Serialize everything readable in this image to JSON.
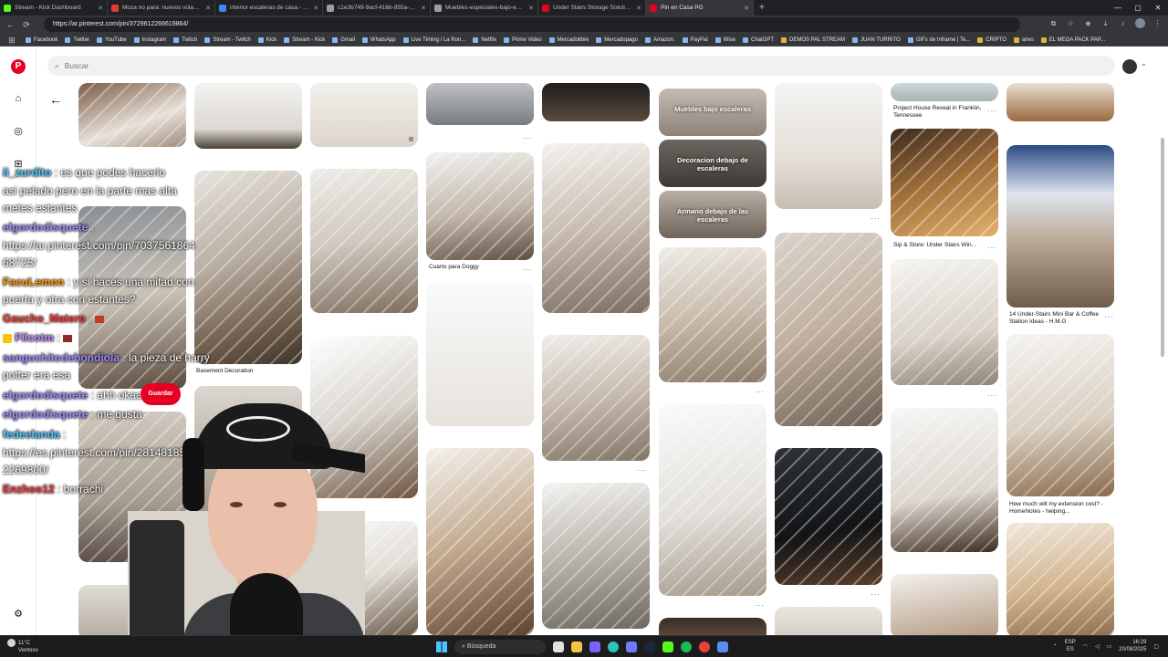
{
  "browser": {
    "tabs": [
      {
        "title": "Stream - Kick Dashboard",
        "color": "#53fc18",
        "active": false
      },
      {
        "title": "Moza no para: nuevos volantes, l...",
        "color": "#e53935",
        "active": false
      },
      {
        "title": "interior escaleras de casa - Buscar",
        "color": "#4285f4",
        "active": false
      },
      {
        "title": "c1e3b749-9acf-416b-955a-3fb47...",
        "color": "#9e9e9e",
        "active": false
      },
      {
        "title": "Muebles-especiales-bajo-escalera...",
        "color": "#9e9e9e",
        "active": false
      },
      {
        "title": "Under Stairs Storage Solutions, B...",
        "color": "#e60023",
        "active": false
      },
      {
        "title": "Pin en Casa PG",
        "color": "#e60023",
        "active": true
      }
    ],
    "new_tab": "+",
    "url": "https://ar.pinterest.com/pin/3729612266619864/",
    "bookmarks": [
      {
        "label": "Facebook",
        "folder": false
      },
      {
        "label": "Twitter",
        "folder": false
      },
      {
        "label": "YouTube",
        "folder": false
      },
      {
        "label": "Instagram",
        "folder": false
      },
      {
        "label": "Twitch",
        "folder": false
      },
      {
        "label": "Stream - Twitch",
        "folder": false
      },
      {
        "label": "Kick",
        "folder": false
      },
      {
        "label": "Stream - Kick",
        "folder": false
      },
      {
        "label": "Gmail",
        "folder": false
      },
      {
        "label": "WhatsApp",
        "folder": false
      },
      {
        "label": "Live Timing / La Ron...",
        "folder": false
      },
      {
        "label": "Netflix",
        "folder": false
      },
      {
        "label": "Prime Video",
        "folder": false
      },
      {
        "label": "Mercadolibre",
        "folder": false
      },
      {
        "label": "Mercadopago",
        "folder": false
      },
      {
        "label": "Amazon.",
        "folder": false
      },
      {
        "label": "PayPal",
        "folder": false
      },
      {
        "label": "Wise",
        "folder": false
      },
      {
        "label": "ChatGPT",
        "folder": false
      },
      {
        "label": "DEMOS PAL STREAM",
        "folder": true
      },
      {
        "label": "JUAN TURRITO",
        "folder": false
      },
      {
        "label": "GIFs de Inframe | Te...",
        "folder": false
      },
      {
        "label": "CRIPTO",
        "folder": true
      },
      {
        "label": "aires",
        "folder": true
      },
      {
        "label": "EL MEGA PACK PAP...",
        "folder": true
      }
    ]
  },
  "pinterest": {
    "search_placeholder": "Buscar",
    "pins": [
      {
        "label": "Muebles bajo escaleras"
      },
      {
        "label": "Decoracion debajo de escaleras"
      },
      {
        "label": "Armario debajo de las escaleras"
      }
    ],
    "captions": {
      "basement": "Basement Decoration",
      "doggy": "Cuarto para Doggy",
      "project_house": "Project House Reveal in Franklin, Tennessee",
      "sip_store": "Sip & Store: Under Stairs Win...",
      "minibar": "14 Under-Stairs Mini Bar & Coffee Station Ideas - H.M.G",
      "extension": "How much will my extension cost? - HomeNotes - helping..."
    },
    "save_button": "Guardar",
    "more": "···"
  },
  "chat": [
    {
      "user": "ii_zurdito",
      "user_color": "#4fc3f7",
      "text": ": es que podes hacerlo"
    },
    {
      "user": "",
      "user_color": "#ffffff",
      "text": "asi pelado pero en la parte mas alta"
    },
    {
      "user": "",
      "user_color": "#ffffff",
      "text": "metes estantes"
    },
    {
      "user": "elgordodisquete",
      "user_color": "#9c8cff",
      "text": ":"
    },
    {
      "user": "",
      "user_color": "#ffffff",
      "text": "https://ar.pinterest.com/pin/7037561864"
    },
    {
      "user": "",
      "user_color": "#ffffff",
      "text": "68725/"
    },
    {
      "user": "FacuLemon",
      "user_color": "#ff9800",
      "text": ": y si hacés una mitad con"
    },
    {
      "user": "",
      "user_color": "#ffffff",
      "text": "puerta y otra con estantes?"
    },
    {
      "user": "Gaucho_Matero",
      "user_color": "#ff3b3b",
      "text": ":"
    },
    {
      "user": "Filcotm",
      "user_color": "#b388ff",
      "text": ":"
    },
    {
      "user": "sanguchitodebondiola",
      "user_color": "#9c8cff",
      "text": ": la pieza de harry"
    },
    {
      "user": "",
      "user_color": "#ffffff",
      "text": "potter era esa"
    },
    {
      "user": "elgordodisquete",
      "user_color": "#9c8cff",
      "text": ": ahh okaa"
    },
    {
      "user": "elgordodisquete",
      "user_color": "#9c8cff",
      "text": ": me gusta"
    },
    {
      "user": "fedeelanda",
      "user_color": "#4fc3f7",
      "text": ":"
    },
    {
      "user": "",
      "user_color": "#ffffff",
      "text": "https://es.pinterest.com/pin/28148185"
    },
    {
      "user": "",
      "user_color": "#ffffff",
      "text": "2269800/"
    },
    {
      "user": "Enzhoo12",
      "user_color": "#ff3b3b",
      "text": ": borrachi"
    }
  ],
  "taskbar": {
    "weather_temp": "11°C",
    "weather_desc": "Ventoso",
    "search_label": "Búsqueda",
    "lang_1": "ESP",
    "lang_2": "ES",
    "time": "16:29",
    "date": "20/08/2025"
  },
  "colors": {
    "pinterest_red": "#e60023",
    "chrome_dark": "#202124"
  }
}
